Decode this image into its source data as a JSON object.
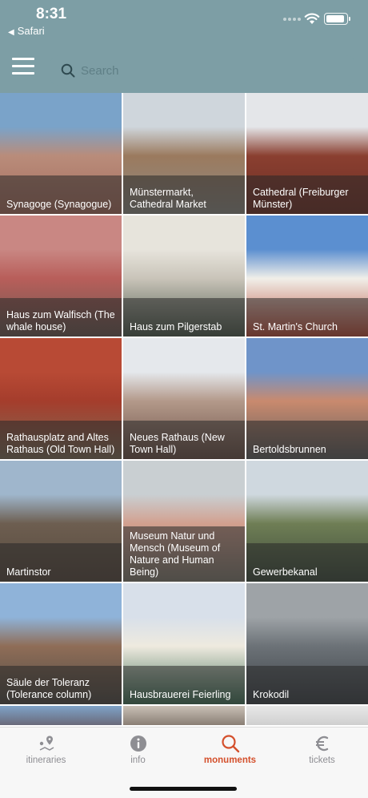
{
  "status_bar": {
    "time": "8:31",
    "back_app": "Safari",
    "icons": [
      "signal-dots-icon",
      "wifi-icon",
      "battery-icon"
    ]
  },
  "header": {
    "menu_icon": "hamburger-menu-icon",
    "search": {
      "placeholder": "Search",
      "value": "",
      "icon": "search-icon"
    }
  },
  "monuments": [
    {
      "caption": "Synagoge (Synagogue)",
      "colors": [
        "#7aa3c9",
        "#b98c7a",
        "#a56d5e"
      ]
    },
    {
      "caption": "Münstermarkt, Cathedral Market",
      "colors": [
        "#cfd6dc",
        "#9b7a5e",
        "#8d8a83"
      ]
    },
    {
      "caption": "Cathedral (Freiburger Münster)",
      "colors": [
        "#e4e6e9",
        "#8a3f30",
        "#6d2f25"
      ]
    },
    {
      "caption": "Haus zum Walfisch (The whale house)",
      "colors": [
        "#c98783",
        "#b85e5a",
        "#6b5a52"
      ]
    },
    {
      "caption": "Haus zum Pilgerstab",
      "colors": [
        "#e7e4dc",
        "#c9c4b9",
        "#4d5a4c"
      ]
    },
    {
      "caption": "St. Martin's Church",
      "colors": [
        "#5b8fd0",
        "#f1efe9",
        "#b64a37"
      ]
    },
    {
      "caption": "Rathausplatz and Altes Rathaus (Old Town Hall)",
      "colors": [
        "#b84a35",
        "#a53d2c",
        "#7c6c57"
      ]
    },
    {
      "caption": "Neues Rathaus (New Town Hall)",
      "colors": [
        "#e5e8ec",
        "#b3998a",
        "#6a4f45"
      ]
    },
    {
      "caption": "Bertoldsbrunnen",
      "colors": [
        "#6f94c9",
        "#c98a6e",
        "#5d5d5d"
      ]
    },
    {
      "caption": "Martinstor",
      "colors": [
        "#9fb6cc",
        "#6d5e50",
        "#57493e"
      ]
    },
    {
      "caption": "Museum Natur und Mensch (Museum of Nature and Human Being)",
      "colors": [
        "#c9cfd2",
        "#d2a08f",
        "#7f7a6f"
      ]
    },
    {
      "caption": "Gewerbekanal",
      "colors": [
        "#cfd8df",
        "#6f7e55",
        "#3c4a3c"
      ]
    },
    {
      "caption": "Säule der Toleranz (Tolerance column)",
      "colors": [
        "#8fb3d9",
        "#8f6d57",
        "#4f4b45"
      ]
    },
    {
      "caption": "Hausbrauerei Feierling",
      "colors": [
        "#d8e0ea",
        "#eeeadf",
        "#3f6e55"
      ]
    },
    {
      "caption": "Krokodil",
      "colors": [
        "#9ea3a7",
        "#6c7277",
        "#3c4146"
      ]
    },
    {
      "caption": "",
      "colors": [
        "#7fa3c8",
        "#6a6a7a"
      ]
    },
    {
      "caption": "",
      "colors": [
        "#c9c0b6",
        "#8a7f75"
      ]
    },
    {
      "caption": "",
      "colors": [
        "#e8e8e8",
        "#cfcfcf"
      ]
    }
  ],
  "tabbar": {
    "tabs": [
      {
        "label": "itineraries",
        "icon": "map-pin-icon",
        "active": false
      },
      {
        "label": "info",
        "icon": "info-icon",
        "active": false
      },
      {
        "label": "monuments",
        "icon": "search-icon",
        "active": true
      },
      {
        "label": "tickets",
        "icon": "euro-icon",
        "active": false
      }
    ],
    "active_color": "#d4502c",
    "inactive_color": "#8e8e93"
  },
  "colors": {
    "header_bg": "#7d9ea5",
    "caption_overlay": "rgba(40,40,40,0.55)"
  }
}
